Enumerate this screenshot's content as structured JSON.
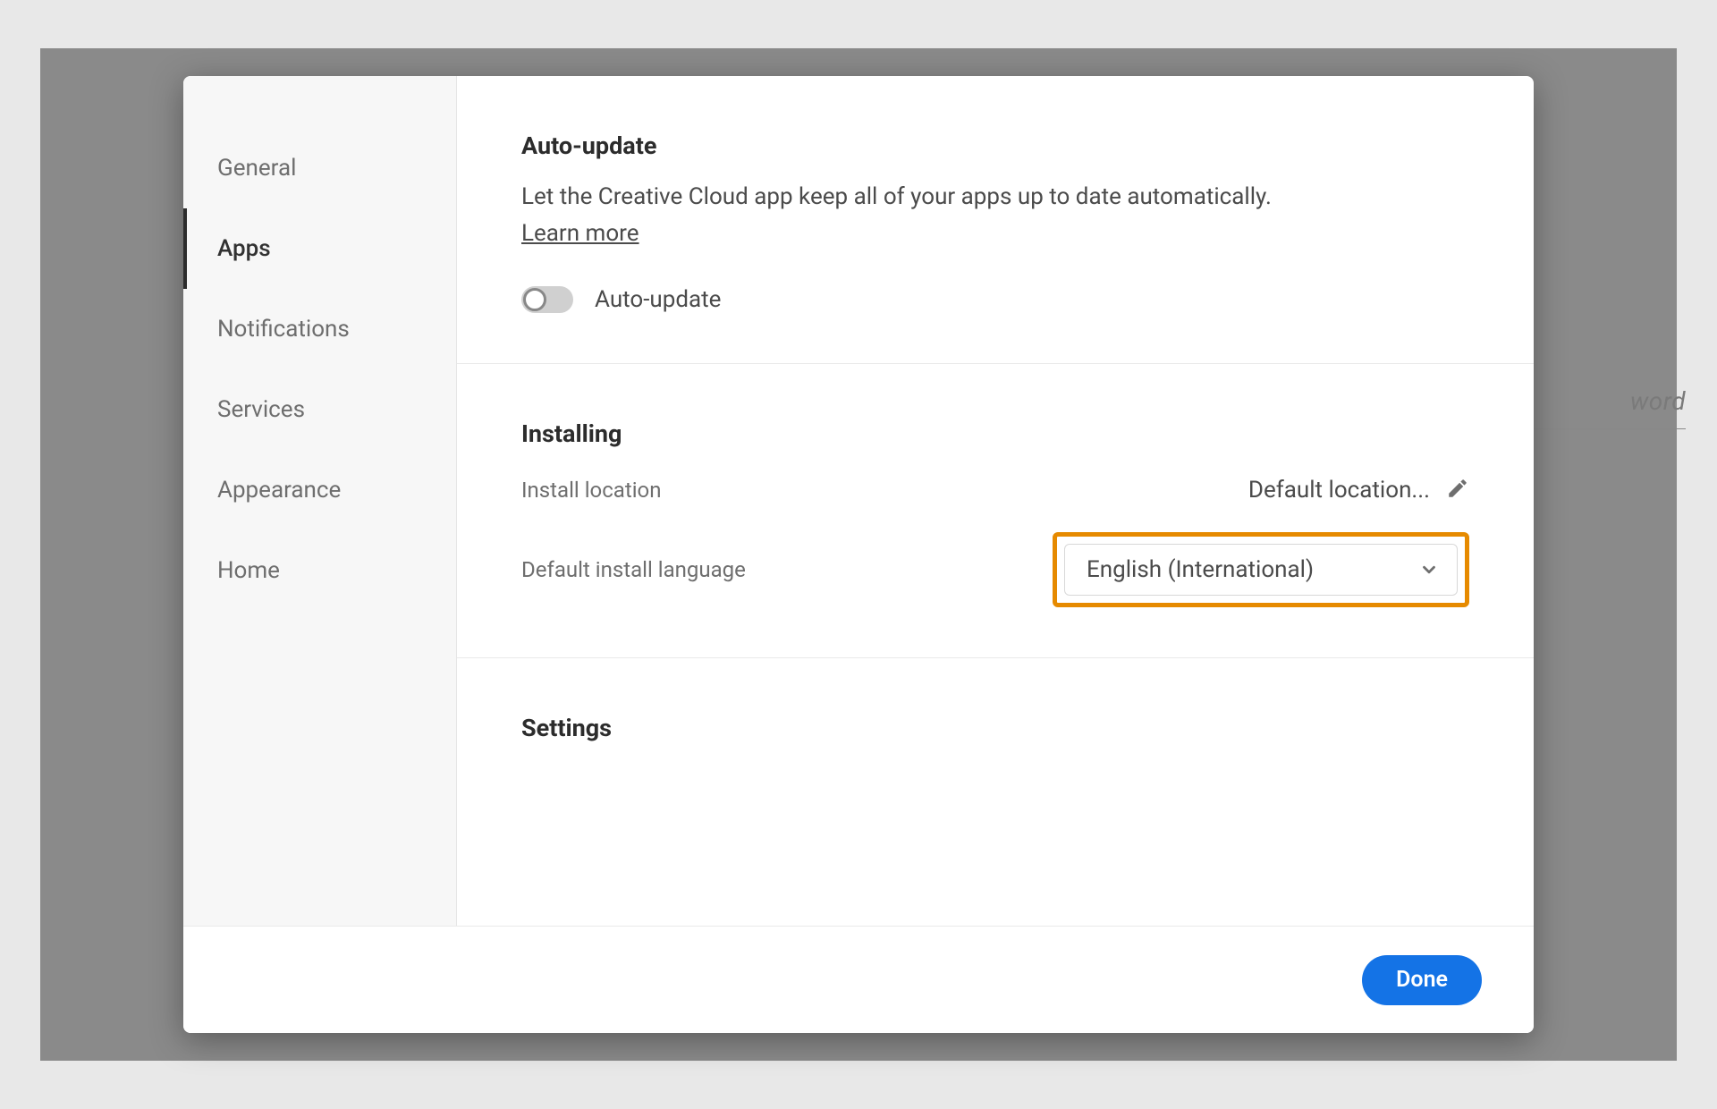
{
  "background": {
    "hint_fragment": "word"
  },
  "sidebar": {
    "items": [
      {
        "label": "General",
        "active": false
      },
      {
        "label": "Apps",
        "active": true
      },
      {
        "label": "Notifications",
        "active": false
      },
      {
        "label": "Services",
        "active": false
      },
      {
        "label": "Appearance",
        "active": false
      },
      {
        "label": "Home",
        "active": false
      }
    ]
  },
  "sections": {
    "auto_update": {
      "title": "Auto-update",
      "description": "Let the Creative Cloud app keep all of your apps up to date automatically.",
      "learn_more": "Learn more",
      "toggle_label": "Auto-update",
      "toggle_on": false
    },
    "installing": {
      "title": "Installing",
      "install_location_label": "Install location",
      "install_location_value": "Default location...",
      "language_label": "Default install language",
      "language_value": "English (International)"
    },
    "settings": {
      "title": "Settings"
    }
  },
  "footer": {
    "done_label": "Done"
  }
}
